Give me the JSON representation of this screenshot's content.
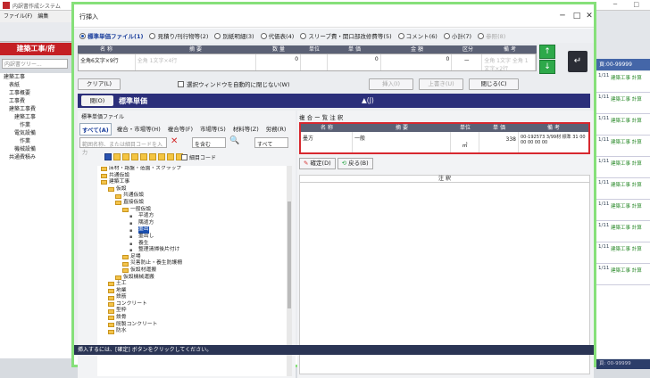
{
  "background": {
    "app_title": "内訳書作成システム",
    "menu": [
      "ファイル(F)",
      "編集"
    ],
    "panel_title": "建築工事/府",
    "tree_search_placeholder": "内訳書ツリー...",
    "tree_items": [
      "建築工事",
      "表紙",
      "工事概要",
      "工事費",
      "建築工事費",
      "建築工事",
      "作業",
      "電気設備",
      "作業",
      "機械設備",
      "共通費積み"
    ],
    "window_controls": [
      "─",
      "□"
    ],
    "right_header": "頁:00-99999",
    "right_rows": [
      {
        "code": "1/11",
        "text": "建築工事 計算"
      },
      {
        "code": "1/11",
        "text": "建築工事 計算"
      },
      {
        "code": "1/11",
        "text": "建築工事 計算"
      },
      {
        "code": "1/11",
        "text": "建築工事 計算"
      },
      {
        "code": "1/11",
        "text": "建築工事 計算"
      },
      {
        "code": "1/11",
        "text": "建築工事 計算"
      },
      {
        "code": "1/11",
        "text": "建築工事 計算"
      },
      {
        "code": "1/11",
        "text": "建築工事 計算"
      },
      {
        "code": "1/11",
        "text": "建築工事 計算"
      },
      {
        "code": "1/11",
        "text": "建築工事 計算"
      }
    ],
    "status": "頁: 00-99999"
  },
  "dialog": {
    "title": "行挿入",
    "controls": {
      "minimize": "─",
      "maximize": "□",
      "close": "✕"
    },
    "radios": [
      {
        "label": "標準単価ファイル(1)",
        "checked": true,
        "disabled": false
      },
      {
        "label": "見積り/刊行物等(2)",
        "checked": false,
        "disabled": false
      },
      {
        "label": "別紙明細(3)",
        "checked": false,
        "disabled": false
      },
      {
        "label": "代価表(4)",
        "checked": false,
        "disabled": false
      },
      {
        "label": "スリーブ費・開口部改修費等(5)",
        "checked": false,
        "disabled": false
      },
      {
        "label": "コメント(6)",
        "checked": false,
        "disabled": false
      },
      {
        "label": "小計(7)",
        "checked": false,
        "disabled": false
      },
      {
        "label": "参照(8)",
        "checked": false,
        "disabled": true
      }
    ],
    "table_headers": [
      "名 称",
      "摘 要",
      "数 量",
      "単位",
      "単 価",
      "金 額",
      "区分",
      "備 考"
    ],
    "table_row": {
      "name": "全角6文字×9行",
      "summary": "全角 1文字×4行",
      "qty": "0",
      "unit": "",
      "price": "0",
      "amount": "0",
      "div": "ー",
      "note": "全角 1文字 全角 1文字×2行"
    },
    "buttons": {
      "clear": "クリア(L)",
      "keep_open_label": "選択ウィンドウを自動的に閉じない(W)",
      "insert": "挿入(I)",
      "overwrite": "上書き(U)",
      "close": "閉じる(C)"
    },
    "arrows": {
      "up": "↑",
      "down": "↓",
      "enter": "↵"
    },
    "tanka": {
      "close_label": "閉(O)",
      "title": "標準単価",
      "updown": "▲(J)"
    },
    "left": {
      "file_label": "標準単価ファイル",
      "tabs": [
        "すべて(A)",
        "複合・市場等(H)",
        "複合等(F)",
        "市場等(S)",
        "材料等(Z)",
        "労務(R)"
      ],
      "search_placeholder": "範囲名称、または細目コードを入力",
      "clear_x": "✕",
      "search_option": "を含む",
      "find": "🔍",
      "scope": "すべて",
      "detail_code": "細目コード",
      "tree": [
        {
          "indent": 0,
          "text": "床材・路盤・造園・スクラップ",
          "leaf": false,
          "selected": false
        },
        {
          "indent": 0,
          "text": "共通仮設",
          "leaf": false,
          "selected": false
        },
        {
          "indent": 0,
          "text": "建築工事",
          "leaf": false,
          "selected": false
        },
        {
          "indent": 1,
          "text": "仮設",
          "leaf": false,
          "selected": false
        },
        {
          "indent": 2,
          "text": "共通仮設",
          "leaf": false,
          "selected": false
        },
        {
          "indent": 2,
          "text": "直接仮設",
          "leaf": false,
          "selected": false
        },
        {
          "indent": 3,
          "text": "一般仮設",
          "leaf": false,
          "selected": false
        },
        {
          "indent": 4,
          "text": "平遣方",
          "leaf": true,
          "selected": false
        },
        {
          "indent": 4,
          "text": "隅遣方",
          "leaf": true,
          "selected": false
        },
        {
          "indent": 4,
          "text": "墨出",
          "leaf": true,
          "selected": true
        },
        {
          "indent": 4,
          "text": "墨出し",
          "leaf": true,
          "selected": false
        },
        {
          "indent": 4,
          "text": "養生",
          "leaf": true,
          "selected": false
        },
        {
          "indent": 4,
          "text": "整理清掃後片付け",
          "leaf": true,
          "selected": false
        },
        {
          "indent": 3,
          "text": "足場",
          "leaf": false,
          "selected": false
        },
        {
          "indent": 3,
          "text": "災害防止・養生防護柵",
          "leaf": false,
          "selected": false
        },
        {
          "indent": 3,
          "text": "仮設材運搬",
          "leaf": false,
          "selected": false
        },
        {
          "indent": 2,
          "text": "仮設機械運搬",
          "leaf": false,
          "selected": false
        },
        {
          "indent": 1,
          "text": "土工",
          "leaf": false,
          "selected": false
        },
        {
          "indent": 1,
          "text": "地業",
          "leaf": false,
          "selected": false
        },
        {
          "indent": 1,
          "text": "鉄筋",
          "leaf": false,
          "selected": false
        },
        {
          "indent": 1,
          "text": "コンクリート",
          "leaf": false,
          "selected": false
        },
        {
          "indent": 1,
          "text": "型枠",
          "leaf": false,
          "selected": false
        },
        {
          "indent": 1,
          "text": "鉄骨",
          "leaf": false,
          "selected": false
        },
        {
          "indent": 1,
          "text": "既製コンクリート",
          "leaf": false,
          "selected": false
        },
        {
          "indent": 1,
          "text": "防水",
          "leaf": false,
          "selected": false
        }
      ]
    },
    "right": {
      "tab_label": "複 合 ー 覧 注 釈",
      "headers": [
        "名 称",
        "摘 要",
        "単位",
        "単 価",
        "備 考"
      ],
      "row": {
        "name": "墨方",
        "summary": "一般",
        "unit": "㎡",
        "price": "338",
        "note": "00-192573 3/99材 標準 31 00 00 00 00 00"
      },
      "confirm": "確定(D)",
      "back": "戻る(B)",
      "note_header": "注 釈"
    },
    "status": "挿入するには、[確定] ボタンをクリックしてください。"
  }
}
